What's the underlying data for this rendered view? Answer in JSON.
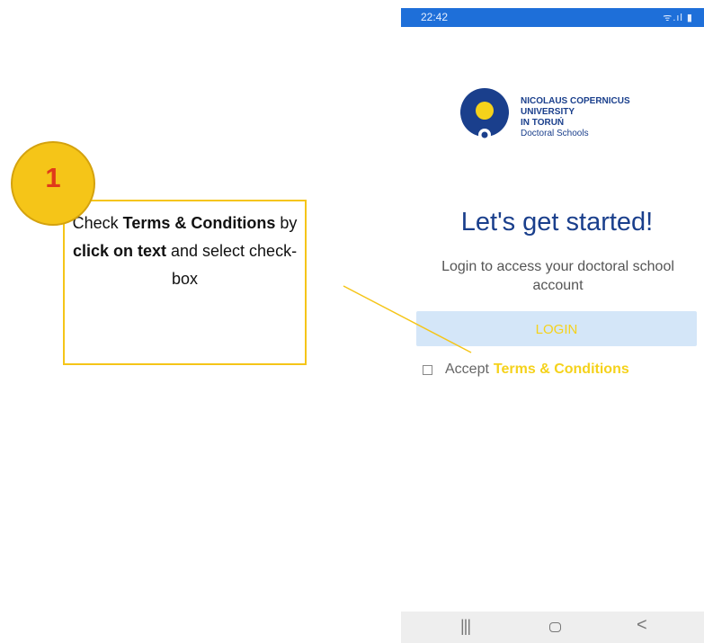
{
  "status_bar": {
    "time": "22:42",
    "icons": "ᯤ.ıl ▮"
  },
  "logo": {
    "line1": "NICOLAUS COPERNICUS",
    "line2": "UNIVERSITY",
    "line3": "IN TORUŃ",
    "line4": "Doctoral Schools",
    "colors": {
      "blue": "#1a3f8c",
      "yellow": "#f5d21b"
    }
  },
  "main": {
    "headline": "Let's get started!",
    "subline": "Login to access your doctoral school account",
    "login_label": "LOGIN",
    "accept_label": "Accept",
    "terms_label": "Terms & Conditions"
  },
  "nav_bar": {
    "recents": "|||",
    "home": "",
    "back": "<"
  },
  "annotation": {
    "number": "1",
    "text_parts": [
      {
        "t": "Check ",
        "b": false
      },
      {
        "t": "Terms & Conditions",
        "b": true
      },
      {
        "t": " by ",
        "b": false
      },
      {
        "t": "click on text",
        "b": true
      },
      {
        "t": " and select check-box",
        "b": false
      }
    ]
  }
}
